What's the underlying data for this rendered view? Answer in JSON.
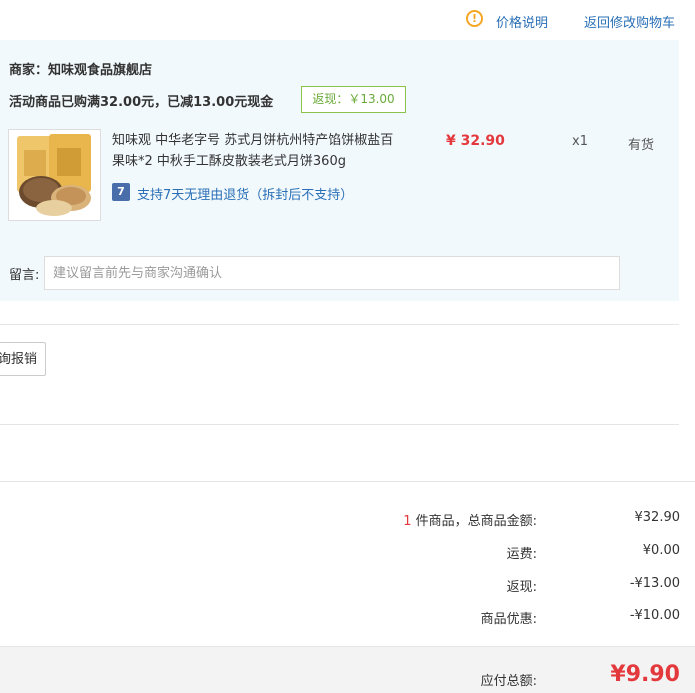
{
  "header": {
    "price_explain_label": "价格说明",
    "back_to_cart_label": "返回修改购物车"
  },
  "shop": {
    "line": "商家：知味观食品旗舰店",
    "promo_text": "活动商品已购满32.00元，已减13.00元现金",
    "cashback_badge": "返现：￥13.00"
  },
  "item": {
    "title": "知味观 中华老字号 苏式月饼杭州特产馅饼椒盐百果味*2 中秋手工酥皮散装老式月饼360g",
    "price": "¥ 32.90",
    "quantity": "x1",
    "stock": "有货",
    "return_policy": "支持7天无理由退货（拆封后不支持）",
    "return_icon_glyph": "7"
  },
  "remark": {
    "label": "留言:",
    "placeholder": "建议留言前先与商家沟通确认"
  },
  "invoice": {
    "button_label": "询报销"
  },
  "summary": {
    "count": "1",
    "count_suffix": " 件商品，总商品金额:",
    "goods_total": "¥32.90",
    "shipping_label": "运费:",
    "shipping_value": "¥0.00",
    "cashback_label": "返现:",
    "cashback_value": "-¥13.00",
    "discount_label": "商品优惠:",
    "discount_value": "-¥10.00",
    "payable_label": "应付总额:",
    "payable_value": "¥9.90"
  },
  "colors": {
    "accent_red": "#e4393c",
    "link_blue": "#2a6fb6",
    "panel_bg": "#f2f9fd",
    "badge_green": "#6aaa3a",
    "warn_orange": "#f5a623"
  }
}
